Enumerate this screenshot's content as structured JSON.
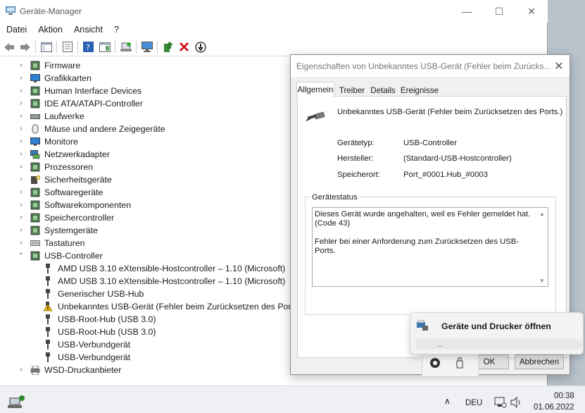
{
  "window": {
    "title": "Geräte-Manager",
    "minimize": "—",
    "maximize": "☐",
    "close": "✕"
  },
  "menu": [
    "Datei",
    "Aktion",
    "Ansicht",
    "?"
  ],
  "tree": {
    "categories": [
      {
        "label": "Firmware",
        "icon": "firmware-icon"
      },
      {
        "label": "Grafikkarten",
        "icon": "display-adapter-icon"
      },
      {
        "label": "Human Interface Devices",
        "icon": "hid-icon"
      },
      {
        "label": "IDE ATA/ATAPI-Controller",
        "icon": "ide-controller-icon"
      },
      {
        "label": "Laufwerke",
        "icon": "disk-drive-icon"
      },
      {
        "label": "Mäuse und andere Zeigegeräte",
        "icon": "mouse-icon"
      },
      {
        "label": "Monitore",
        "icon": "monitor-icon"
      },
      {
        "label": "Netzwerkadapter",
        "icon": "network-adapter-icon"
      },
      {
        "label": "Prozessoren",
        "icon": "processor-icon"
      },
      {
        "label": "Sicherheitsgeräte",
        "icon": "security-device-icon"
      },
      {
        "label": "Softwaregeräte",
        "icon": "software-device-icon"
      },
      {
        "label": "Softwarekomponenten",
        "icon": "software-component-icon"
      },
      {
        "label": "Speichercontroller",
        "icon": "storage-controller-icon"
      },
      {
        "label": "Systemgeräte",
        "icon": "system-device-icon"
      },
      {
        "label": "Tastaturen",
        "icon": "keyboard-icon"
      },
      {
        "label": "USB-Controller",
        "icon": "usb-controller-icon",
        "expanded": true
      }
    ],
    "usb_children": [
      {
        "label": "AMD USB 3.10 eXtensible-Hostcontroller – 1.10 (Microsoft)",
        "warning": false
      },
      {
        "label": "AMD USB 3.10 eXtensible-Hostcontroller – 1.10 (Microsoft)",
        "warning": false
      },
      {
        "label": "Generischer USB-Hub",
        "warning": false
      },
      {
        "label": "Unbekanntes USB-Gerät (Fehler beim Zurücksetzen des Ports.)",
        "warning": true
      },
      {
        "label": "USB-Root-Hub (USB 3.0)",
        "warning": false
      },
      {
        "label": "USB-Root-Hub (USB 3.0)",
        "warning": false
      },
      {
        "label": "USB-Verbundgerät",
        "warning": false
      },
      {
        "label": "USB-Verbundgerät",
        "warning": false
      }
    ],
    "last": {
      "label": "WSD-Druckanbieter",
      "icon": "printer-icon"
    }
  },
  "dialog": {
    "title": "Eigenschaften von Unbekanntes USB-Gerät (Fehler beim Zurücks...",
    "close": "✕",
    "tabs": [
      "Allgemein",
      "Treiber",
      "Details",
      "Ereignisse"
    ],
    "active_tab": "Allgemein",
    "device_name": "Unbekanntes USB-Gerät (Fehler beim Zurücksetzen des Ports.)",
    "props": [
      {
        "label": "Gerätetyp:",
        "value": "USB-Controller"
      },
      {
        "label": "Hersteller:",
        "value": "(Standard-USB-Hostcontroller)"
      },
      {
        "label": "Speicherort:",
        "value": "Port_#0001.Hub_#0003"
      }
    ],
    "status_legend": "Gerätestatus",
    "status_line1": "Dieses Gerät wurde angehalten, weil es Fehler gemeldet hat.",
    "status_line2": "(Code 43)",
    "status_line3": "Fehler bei einer Anforderung zum Zurücksetzen des USB-Ports.",
    "ok": "OK",
    "cancel": "Abbrechen"
  },
  "jumplist": {
    "item": "Geräte und Drucker öffnen",
    "sub": "..."
  },
  "taskbar": {
    "language": "DEU",
    "time": "00:38",
    "date": "01.06.2022"
  },
  "colors": {
    "accent": "#0067c0",
    "warning": "#f0c000",
    "error_red": "#d00000"
  }
}
